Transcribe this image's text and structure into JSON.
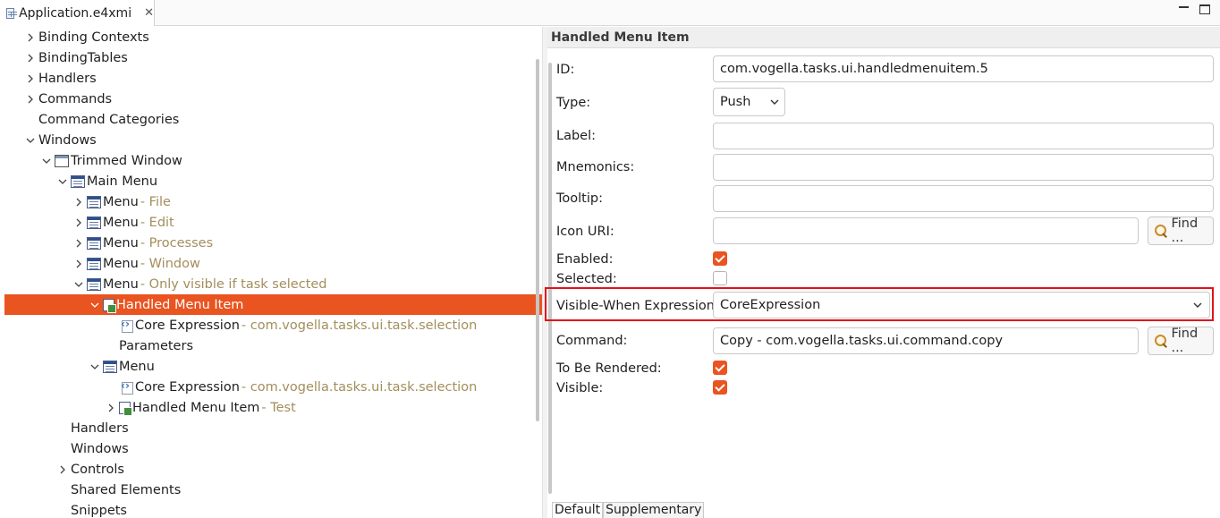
{
  "editor_tab": {
    "title": "Application.e4xmi",
    "close": "✕"
  },
  "colors": {
    "accent": "#e95420",
    "detail": "#a38e5c",
    "highlight": "#e0121b"
  },
  "tree": [
    {
      "label": "Binding Contexts",
      "detail": "",
      "level": 1,
      "twisty": "collapsed",
      "icon": ""
    },
    {
      "label": "BindingTables",
      "detail": "",
      "level": 1,
      "twisty": "collapsed",
      "icon": ""
    },
    {
      "label": "Handlers",
      "detail": "",
      "level": 1,
      "twisty": "collapsed",
      "icon": ""
    },
    {
      "label": "Commands",
      "detail": "",
      "level": 1,
      "twisty": "collapsed",
      "icon": ""
    },
    {
      "label": "Command Categories",
      "detail": "",
      "level": 1,
      "twisty": "none",
      "icon": ""
    },
    {
      "label": "Windows",
      "detail": "",
      "level": 1,
      "twisty": "expanded",
      "icon": ""
    },
    {
      "label": "Trimmed Window",
      "detail": "",
      "level": 2,
      "twisty": "expanded",
      "icon": "window-icon"
    },
    {
      "label": "Main Menu",
      "detail": "",
      "level": 3,
      "twisty": "expanded",
      "icon": "menu-icon"
    },
    {
      "label": "Menu",
      "detail": "- File",
      "level": 4,
      "twisty": "collapsed",
      "icon": "menu-icon"
    },
    {
      "label": "Menu",
      "detail": "- Edit",
      "level": 4,
      "twisty": "collapsed",
      "icon": "menu-icon"
    },
    {
      "label": "Menu",
      "detail": "- Processes",
      "level": 4,
      "twisty": "collapsed",
      "icon": "menu-icon"
    },
    {
      "label": "Menu",
      "detail": "- Window",
      "level": 4,
      "twisty": "collapsed",
      "icon": "menu-icon"
    },
    {
      "label": "Menu",
      "detail": "- Only visible if task selected",
      "level": 4,
      "twisty": "expanded",
      "icon": "menu-icon"
    },
    {
      "label": "Handled Menu Item",
      "detail": "",
      "level": 5,
      "twisty": "expanded",
      "icon": "handled-menu-item-icon",
      "selected": true
    },
    {
      "label": "Core Expression",
      "detail": "- com.vogella.tasks.ui.task.selection",
      "level": 6,
      "twisty": "none",
      "icon": "core-expression-icon"
    },
    {
      "label": "Parameters",
      "detail": "",
      "level": 6,
      "twisty": "none",
      "icon": ""
    },
    {
      "label": "Menu",
      "detail": "",
      "level": 5,
      "twisty": "expanded",
      "icon": "menu-icon"
    },
    {
      "label": "Core Expression",
      "detail": "- com.vogella.tasks.ui.task.selection",
      "level": 6,
      "twisty": "none",
      "icon": "core-expression-icon"
    },
    {
      "label": "Handled Menu Item",
      "detail": "- Test",
      "level": 6,
      "twisty": "collapsed",
      "icon": "handled-menu-item-icon"
    },
    {
      "label": "Handlers",
      "detail": "",
      "level": 3,
      "twisty": "none",
      "icon": ""
    },
    {
      "label": "Windows",
      "detail": "",
      "level": 3,
      "twisty": "none",
      "icon": ""
    },
    {
      "label": "Controls",
      "detail": "",
      "level": 3,
      "twisty": "collapsed",
      "icon": ""
    },
    {
      "label": "Shared Elements",
      "detail": "",
      "level": 3,
      "twisty": "none",
      "icon": ""
    },
    {
      "label": "Snippets",
      "detail": "",
      "level": 3,
      "twisty": "none",
      "icon": ""
    }
  ],
  "props": {
    "title": "Handled Menu Item",
    "id_label": "ID:",
    "id_value": "com.vogella.tasks.ui.handledmenuitem.5",
    "type_label": "Type:",
    "type_value": "Push",
    "label_label": "Label:",
    "label_value": "",
    "mnemonics_label": "Mnemonics:",
    "mnemonics_value": "",
    "tooltip_label": "Tooltip:",
    "tooltip_value": "",
    "icon_label": "Icon URI:",
    "icon_value": "",
    "find_label": "Find ...",
    "enabled_label": "Enabled:",
    "enabled": true,
    "selected_label": "Selected:",
    "selected": false,
    "visible_when_label": "Visible-When Expression:",
    "visible_when_value": "CoreExpression",
    "command_label": "Command:",
    "command_value": "Copy  - com.vogella.tasks.ui.command.copy",
    "to_be_rendered_label": "To Be Rendered:",
    "to_be_rendered": true,
    "visible_label": "Visible:",
    "visible": true
  },
  "bottom_tabs": [
    "Default",
    "Supplementary"
  ]
}
